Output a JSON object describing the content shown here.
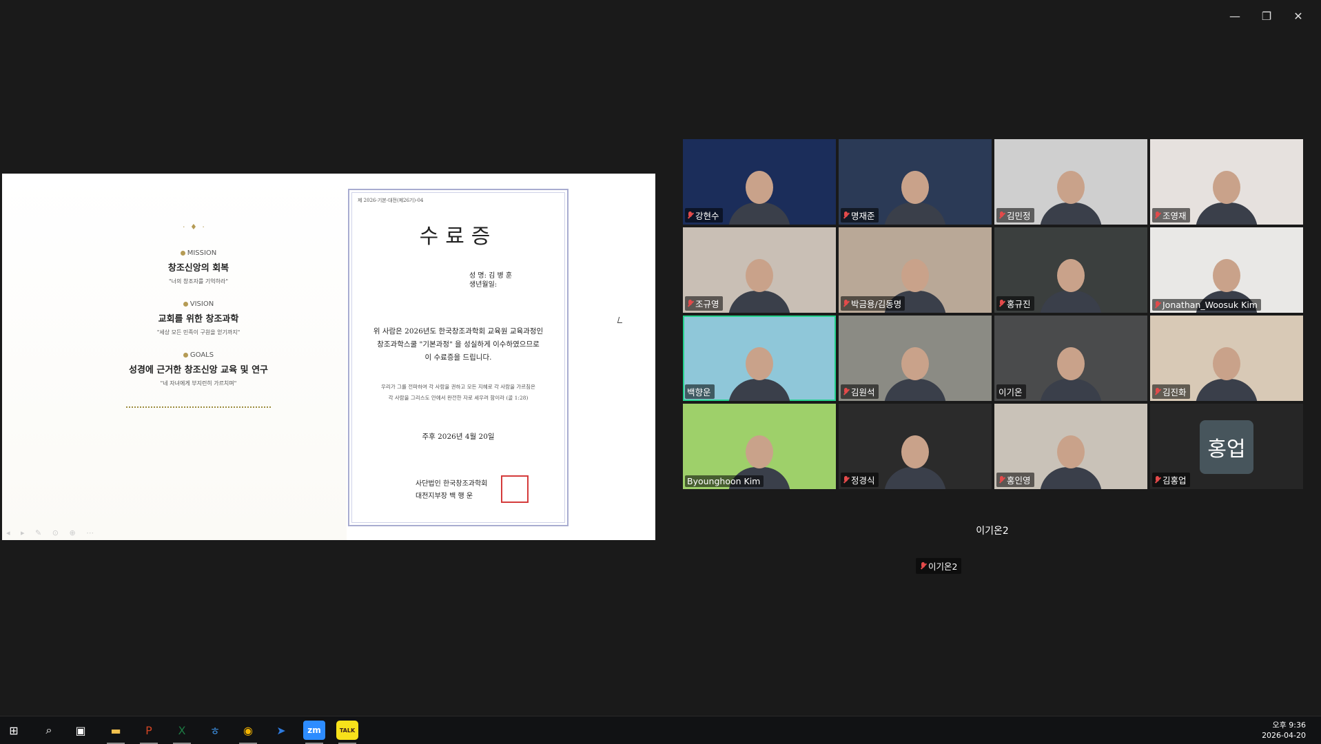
{
  "window": {
    "minimize": "—",
    "restore": "❐",
    "close": "✕"
  },
  "slide": {
    "left": {
      "ornament": "· ♦ ·",
      "mission": {
        "head": "MISSION",
        "title": "창조신앙의 회복",
        "sub": "\"너의 창조자를 기억하라\""
      },
      "vision": {
        "head": "VISION",
        "title": "교회를 위한 창조과학",
        "sub": "\"세상 모든 민족이 구원을 얻기까지\""
      },
      "goals": {
        "head": "GOALS",
        "title": "성경에 근거한 창조신앙 교육 및 연구",
        "sub": "\"네 자녀에게 부지런히 가르치며\""
      },
      "toolbar": "◂ ▸ ✎ ⊙ ⊕ ⋯"
    },
    "cert": {
      "number": "제 2026-기본-대전(제26기)-04",
      "title": "수료증",
      "name_line": "성 명: 김 병 훈",
      "birth_line": "생년월일:",
      "body_lines": [
        "위 사람은 2026년도 한국창조과학회 교육원 교육과정인",
        "창조과학스쿨 \"기본과정\" 을 성실하게 이수하였으므로",
        "이 수료증을 드립니다."
      ],
      "verse_lines": [
        "우리가 그를 전파하여 각 사람을 권하고 모든 지혜로 각 사람을 가르침은",
        "각 사람을 그리스도 안에서 완전한 자로 세우려 함이라 (골 1:28)"
      ],
      "date": "주후 2026년 4월 20일",
      "org_line1": "사단법인 한국창조과학회",
      "org_line2": "대전지부장 백 행 운",
      "seal": "한국창조과학회"
    }
  },
  "participants": [
    {
      "name": "강현수",
      "muted": true,
      "bg": "#1b2d5a"
    },
    {
      "name": "명재준",
      "muted": true,
      "bg": "#2b3a56"
    },
    {
      "name": "김민정",
      "muted": true,
      "bg": "#cfcfcf"
    },
    {
      "name": "조영재",
      "muted": true,
      "bg": "#e6e1de"
    },
    {
      "name": "조규영",
      "muted": true,
      "bg": "#c9bfb5"
    },
    {
      "name": "박금용/김동명",
      "muted": true,
      "bg": "#b9a897"
    },
    {
      "name": "홍규진",
      "muted": true,
      "bg": "#3b3f3e"
    },
    {
      "name": "Jonathan_Woosuk Kim",
      "muted": true,
      "bg": "#e9e8e6"
    },
    {
      "name": "백향운",
      "muted": false,
      "bg": "#8fc7d9",
      "active": true
    },
    {
      "name": "김원석",
      "muted": true,
      "bg": "#8b8b84"
    },
    {
      "name": "이기온",
      "muted": false,
      "bg": "#4a4b4c"
    },
    {
      "name": "김진화",
      "muted": true,
      "bg": "#d8c9b6"
    },
    {
      "name": "Byounghoon Kim",
      "muted": false,
      "bg": "#9ed06a"
    },
    {
      "name": "정경식",
      "muted": true,
      "bg": "#2b2b2b"
    },
    {
      "name": "홍인영",
      "muted": true,
      "bg": "#c9c2b8"
    },
    {
      "name": "김홍업",
      "muted": true,
      "bg": "#262626",
      "avatar": "홍업"
    }
  ],
  "overflow": {
    "big_name": "이기온2",
    "label": "이기온2"
  },
  "taskbar": {
    "icons": [
      {
        "name": "windows-start-icon",
        "glyph": "⊞",
        "color": "#ffffff",
        "open": false
      },
      {
        "name": "search-icon",
        "glyph": "⌕",
        "color": "#ffffff",
        "open": false
      },
      {
        "name": "task-view-icon",
        "glyph": "▣",
        "color": "#ffffff",
        "open": false
      },
      {
        "name": "file-explorer-icon",
        "glyph": "▬",
        "color": "#f2c14e",
        "open": true
      },
      {
        "name": "powerpoint-icon",
        "glyph": "P",
        "color": "#d04423",
        "open": true
      },
      {
        "name": "excel-icon",
        "glyph": "X",
        "color": "#1d7a43",
        "open": true
      },
      {
        "name": "hwp-icon",
        "glyph": "ㅎ",
        "color": "#3c8dde",
        "open": false
      },
      {
        "name": "chrome-icon",
        "glyph": "◉",
        "color": "#f4b400",
        "open": true
      },
      {
        "name": "pin-app-icon",
        "glyph": "➤",
        "color": "#2d7be0",
        "open": false
      },
      {
        "name": "zoom-icon",
        "glyph": "zm",
        "color": "#2d8cff",
        "open": true
      },
      {
        "name": "kakaotalk-icon",
        "glyph": "TALK",
        "color": "#f7e11b",
        "open": true
      }
    ],
    "time": "오후 9:36",
    "date": "2026-04-20"
  }
}
